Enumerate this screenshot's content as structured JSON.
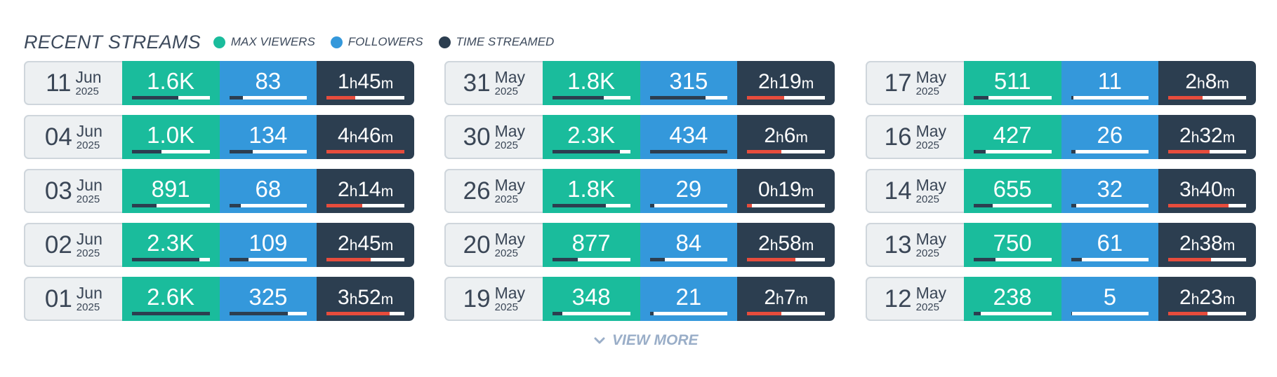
{
  "header": {
    "title": "RECENT STREAMS",
    "legend": [
      {
        "label": "MAX VIEWERS",
        "color": "#1abc9c"
      },
      {
        "label": "FOLLOWERS",
        "color": "#3498db"
      },
      {
        "label": "TIME STREAMED",
        "color": "#2c3e50"
      }
    ]
  },
  "columns": [
    [
      {
        "day": "11",
        "month": "Jun",
        "year": "2025",
        "viewers": "1.6K",
        "viewers_pct": 0.6,
        "followers": "83",
        "followers_pct": 0.18,
        "hours": "1",
        "minutes": "45",
        "time_pct": 0.37
      },
      {
        "day": "04",
        "month": "Jun",
        "year": "2025",
        "viewers": "1.0K",
        "viewers_pct": 0.38,
        "followers": "134",
        "followers_pct": 0.3,
        "hours": "4",
        "minutes": "46",
        "time_pct": 1.0
      },
      {
        "day": "03",
        "month": "Jun",
        "year": "2025",
        "viewers": "891",
        "viewers_pct": 0.32,
        "followers": "68",
        "followers_pct": 0.15,
        "hours": "2",
        "minutes": "14",
        "time_pct": 0.46
      },
      {
        "day": "02",
        "month": "Jun",
        "year": "2025",
        "viewers": "2.3K",
        "viewers_pct": 0.87,
        "followers": "109",
        "followers_pct": 0.25,
        "hours": "2",
        "minutes": "45",
        "time_pct": 0.57
      },
      {
        "day": "01",
        "month": "Jun",
        "year": "2025",
        "viewers": "2.6K",
        "viewers_pct": 1.0,
        "followers": "325",
        "followers_pct": 0.75,
        "hours": "3",
        "minutes": "52",
        "time_pct": 0.81
      }
    ],
    [
      {
        "day": "31",
        "month": "May",
        "year": "2025",
        "viewers": "1.8K",
        "viewers_pct": 0.66,
        "followers": "315",
        "followers_pct": 0.72,
        "hours": "2",
        "minutes": "19",
        "time_pct": 0.48
      },
      {
        "day": "30",
        "month": "May",
        "year": "2025",
        "viewers": "2.3K",
        "viewers_pct": 0.87,
        "followers": "434",
        "followers_pct": 1.0,
        "hours": "2",
        "minutes": "6",
        "time_pct": 0.44
      },
      {
        "day": "26",
        "month": "May",
        "year": "2025",
        "viewers": "1.8K",
        "viewers_pct": 0.69,
        "followers": "29",
        "followers_pct": 0.06,
        "hours": "0",
        "minutes": "19",
        "time_pct": 0.06
      },
      {
        "day": "20",
        "month": "May",
        "year": "2025",
        "viewers": "877",
        "viewers_pct": 0.33,
        "followers": "84",
        "followers_pct": 0.19,
        "hours": "2",
        "minutes": "58",
        "time_pct": 0.62
      },
      {
        "day": "19",
        "month": "May",
        "year": "2025",
        "viewers": "348",
        "viewers_pct": 0.13,
        "followers": "21",
        "followers_pct": 0.05,
        "hours": "2",
        "minutes": "7",
        "time_pct": 0.44
      }
    ],
    [
      {
        "day": "17",
        "month": "May",
        "year": "2025",
        "viewers": "511",
        "viewers_pct": 0.19,
        "followers": "11",
        "followers_pct": 0.03,
        "hours": "2",
        "minutes": "8",
        "time_pct": 0.44
      },
      {
        "day": "16",
        "month": "May",
        "year": "2025",
        "viewers": "427",
        "viewers_pct": 0.16,
        "followers": "26",
        "followers_pct": 0.06,
        "hours": "2",
        "minutes": "32",
        "time_pct": 0.53
      },
      {
        "day": "14",
        "month": "May",
        "year": "2025",
        "viewers": "655",
        "viewers_pct": 0.25,
        "followers": "32",
        "followers_pct": 0.07,
        "hours": "3",
        "minutes": "40",
        "time_pct": 0.77
      },
      {
        "day": "13",
        "month": "May",
        "year": "2025",
        "viewers": "750",
        "viewers_pct": 0.28,
        "followers": "61",
        "followers_pct": 0.14,
        "hours": "2",
        "minutes": "38",
        "time_pct": 0.55
      },
      {
        "day": "12",
        "month": "May",
        "year": "2025",
        "viewers": "238",
        "viewers_pct": 0.09,
        "followers": "5",
        "followers_pct": 0.01,
        "hours": "2",
        "minutes": "23",
        "time_pct": 0.5
      }
    ]
  ],
  "view_more": {
    "label": "VIEW MORE"
  }
}
